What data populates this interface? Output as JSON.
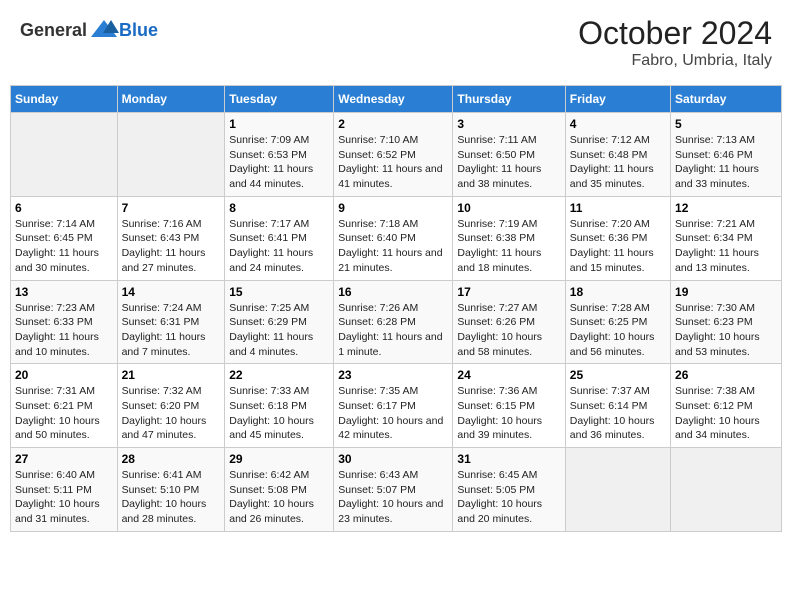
{
  "header": {
    "logo_general": "General",
    "logo_blue": "Blue",
    "month": "October 2024",
    "location": "Fabro, Umbria, Italy"
  },
  "days_of_week": [
    "Sunday",
    "Monday",
    "Tuesday",
    "Wednesday",
    "Thursday",
    "Friday",
    "Saturday"
  ],
  "weeks": [
    [
      {
        "day": "",
        "sunrise": "",
        "sunset": "",
        "daylight": "",
        "empty": true
      },
      {
        "day": "",
        "sunrise": "",
        "sunset": "",
        "daylight": "",
        "empty": true
      },
      {
        "day": "1",
        "sunrise": "Sunrise: 7:09 AM",
        "sunset": "Sunset: 6:53 PM",
        "daylight": "Daylight: 11 hours and 44 minutes."
      },
      {
        "day": "2",
        "sunrise": "Sunrise: 7:10 AM",
        "sunset": "Sunset: 6:52 PM",
        "daylight": "Daylight: 11 hours and 41 minutes."
      },
      {
        "day": "3",
        "sunrise": "Sunrise: 7:11 AM",
        "sunset": "Sunset: 6:50 PM",
        "daylight": "Daylight: 11 hours and 38 minutes."
      },
      {
        "day": "4",
        "sunrise": "Sunrise: 7:12 AM",
        "sunset": "Sunset: 6:48 PM",
        "daylight": "Daylight: 11 hours and 35 minutes."
      },
      {
        "day": "5",
        "sunrise": "Sunrise: 7:13 AM",
        "sunset": "Sunset: 6:46 PM",
        "daylight": "Daylight: 11 hours and 33 minutes."
      }
    ],
    [
      {
        "day": "6",
        "sunrise": "Sunrise: 7:14 AM",
        "sunset": "Sunset: 6:45 PM",
        "daylight": "Daylight: 11 hours and 30 minutes."
      },
      {
        "day": "7",
        "sunrise": "Sunrise: 7:16 AM",
        "sunset": "Sunset: 6:43 PM",
        "daylight": "Daylight: 11 hours and 27 minutes."
      },
      {
        "day": "8",
        "sunrise": "Sunrise: 7:17 AM",
        "sunset": "Sunset: 6:41 PM",
        "daylight": "Daylight: 11 hours and 24 minutes."
      },
      {
        "day": "9",
        "sunrise": "Sunrise: 7:18 AM",
        "sunset": "Sunset: 6:40 PM",
        "daylight": "Daylight: 11 hours and 21 minutes."
      },
      {
        "day": "10",
        "sunrise": "Sunrise: 7:19 AM",
        "sunset": "Sunset: 6:38 PM",
        "daylight": "Daylight: 11 hours and 18 minutes."
      },
      {
        "day": "11",
        "sunrise": "Sunrise: 7:20 AM",
        "sunset": "Sunset: 6:36 PM",
        "daylight": "Daylight: 11 hours and 15 minutes."
      },
      {
        "day": "12",
        "sunrise": "Sunrise: 7:21 AM",
        "sunset": "Sunset: 6:34 PM",
        "daylight": "Daylight: 11 hours and 13 minutes."
      }
    ],
    [
      {
        "day": "13",
        "sunrise": "Sunrise: 7:23 AM",
        "sunset": "Sunset: 6:33 PM",
        "daylight": "Daylight: 11 hours and 10 minutes."
      },
      {
        "day": "14",
        "sunrise": "Sunrise: 7:24 AM",
        "sunset": "Sunset: 6:31 PM",
        "daylight": "Daylight: 11 hours and 7 minutes."
      },
      {
        "day": "15",
        "sunrise": "Sunrise: 7:25 AM",
        "sunset": "Sunset: 6:29 PM",
        "daylight": "Daylight: 11 hours and 4 minutes."
      },
      {
        "day": "16",
        "sunrise": "Sunrise: 7:26 AM",
        "sunset": "Sunset: 6:28 PM",
        "daylight": "Daylight: 11 hours and 1 minute."
      },
      {
        "day": "17",
        "sunrise": "Sunrise: 7:27 AM",
        "sunset": "Sunset: 6:26 PM",
        "daylight": "Daylight: 10 hours and 58 minutes."
      },
      {
        "day": "18",
        "sunrise": "Sunrise: 7:28 AM",
        "sunset": "Sunset: 6:25 PM",
        "daylight": "Daylight: 10 hours and 56 minutes."
      },
      {
        "day": "19",
        "sunrise": "Sunrise: 7:30 AM",
        "sunset": "Sunset: 6:23 PM",
        "daylight": "Daylight: 10 hours and 53 minutes."
      }
    ],
    [
      {
        "day": "20",
        "sunrise": "Sunrise: 7:31 AM",
        "sunset": "Sunset: 6:21 PM",
        "daylight": "Daylight: 10 hours and 50 minutes."
      },
      {
        "day": "21",
        "sunrise": "Sunrise: 7:32 AM",
        "sunset": "Sunset: 6:20 PM",
        "daylight": "Daylight: 10 hours and 47 minutes."
      },
      {
        "day": "22",
        "sunrise": "Sunrise: 7:33 AM",
        "sunset": "Sunset: 6:18 PM",
        "daylight": "Daylight: 10 hours and 45 minutes."
      },
      {
        "day": "23",
        "sunrise": "Sunrise: 7:35 AM",
        "sunset": "Sunset: 6:17 PM",
        "daylight": "Daylight: 10 hours and 42 minutes."
      },
      {
        "day": "24",
        "sunrise": "Sunrise: 7:36 AM",
        "sunset": "Sunset: 6:15 PM",
        "daylight": "Daylight: 10 hours and 39 minutes."
      },
      {
        "day": "25",
        "sunrise": "Sunrise: 7:37 AM",
        "sunset": "Sunset: 6:14 PM",
        "daylight": "Daylight: 10 hours and 36 minutes."
      },
      {
        "day": "26",
        "sunrise": "Sunrise: 7:38 AM",
        "sunset": "Sunset: 6:12 PM",
        "daylight": "Daylight: 10 hours and 34 minutes."
      }
    ],
    [
      {
        "day": "27",
        "sunrise": "Sunrise: 6:40 AM",
        "sunset": "Sunset: 5:11 PM",
        "daylight": "Daylight: 10 hours and 31 minutes."
      },
      {
        "day": "28",
        "sunrise": "Sunrise: 6:41 AM",
        "sunset": "Sunset: 5:10 PM",
        "daylight": "Daylight: 10 hours and 28 minutes."
      },
      {
        "day": "29",
        "sunrise": "Sunrise: 6:42 AM",
        "sunset": "Sunset: 5:08 PM",
        "daylight": "Daylight: 10 hours and 26 minutes."
      },
      {
        "day": "30",
        "sunrise": "Sunrise: 6:43 AM",
        "sunset": "Sunset: 5:07 PM",
        "daylight": "Daylight: 10 hours and 23 minutes."
      },
      {
        "day": "31",
        "sunrise": "Sunrise: 6:45 AM",
        "sunset": "Sunset: 5:05 PM",
        "daylight": "Daylight: 10 hours and 20 minutes."
      },
      {
        "day": "",
        "sunrise": "",
        "sunset": "",
        "daylight": "",
        "empty": true
      },
      {
        "day": "",
        "sunrise": "",
        "sunset": "",
        "daylight": "",
        "empty": true
      }
    ]
  ]
}
